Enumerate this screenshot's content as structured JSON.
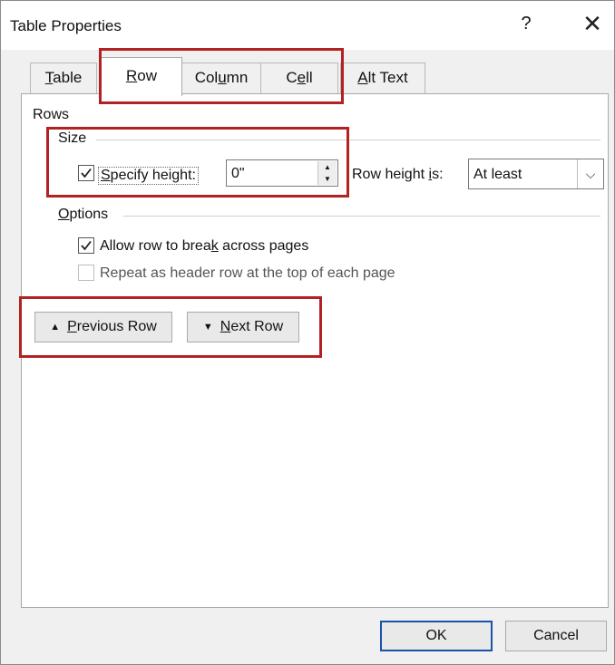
{
  "window": {
    "title": "Table Properties",
    "help_label": "?",
    "close_label": "✕"
  },
  "tabs": [
    {
      "label_pre": "",
      "label_u": "T",
      "label_post": "able"
    },
    {
      "label_pre": "",
      "label_u": "R",
      "label_post": "ow"
    },
    {
      "label_pre": "Col",
      "label_u": "u",
      "label_post": "mn"
    },
    {
      "label_pre": "C",
      "label_u": "e",
      "label_post": "ll"
    },
    {
      "label_pre": "",
      "label_u": "A",
      "label_post": "lt Text"
    }
  ],
  "active_tab": "Row",
  "rows_section": {
    "heading": "Rows",
    "size": {
      "heading": "Size",
      "specify_height": {
        "label_pre": "",
        "label_u": "S",
        "label_post": "pecify height:",
        "checked": true
      },
      "height_value": "0\"",
      "row_height_is_label_pre": "Row height ",
      "row_height_is_label_u": "i",
      "row_height_is_label_post": "s:",
      "row_height_is_value": "At least"
    },
    "options": {
      "heading_pre": "",
      "heading_u": "O",
      "heading_post": "ptions",
      "allow_break": {
        "label_pre": "Allow row to brea",
        "label_u": "k",
        "label_post": " across pages",
        "checked": true
      },
      "repeat_header": {
        "label": "Repeat as header row at the top of each page",
        "checked": false,
        "enabled": false
      }
    }
  },
  "nav_buttons": {
    "previous": {
      "label_pre": "",
      "label_u": "P",
      "label_post": "revious Row"
    },
    "next": {
      "label_pre": "",
      "label_u": "N",
      "label_post": "ext Row"
    }
  },
  "footer": {
    "ok_label": "OK",
    "cancel_label": "Cancel"
  },
  "colors": {
    "highlight": "#b22222",
    "ok_focus_border": "#1a52a8"
  }
}
